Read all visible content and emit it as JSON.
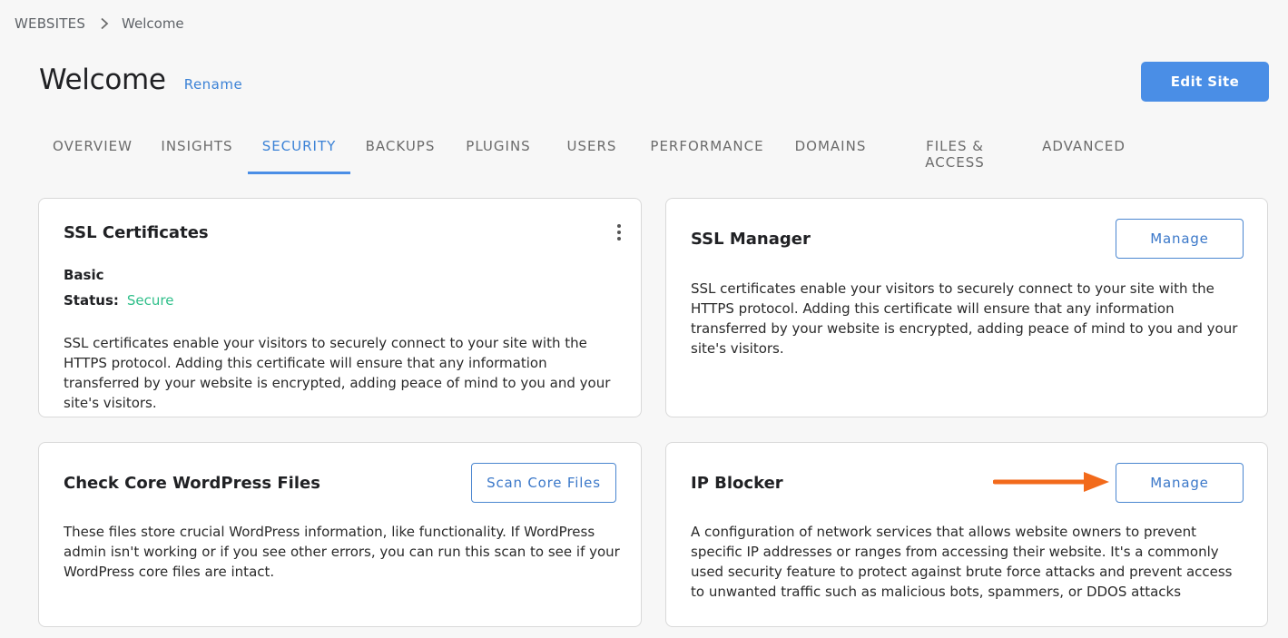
{
  "breadcrumb": {
    "root": "WEBSITES",
    "current": "Welcome"
  },
  "header": {
    "title": "Welcome",
    "rename_label": "Rename",
    "edit_label": "Edit Site"
  },
  "tabs": [
    "OVERVIEW",
    "INSIGHTS",
    "SECURITY",
    "BACKUPS",
    "PLUGINS",
    "USERS",
    "PERFORMANCE",
    "DOMAINS",
    "FILES & ACCESS",
    "ADVANCED"
  ],
  "active_tab": "SECURITY",
  "ssl_certificates": {
    "title": "SSL Certificates",
    "plan": "Basic",
    "status_label": "Status:",
    "status_value": "Secure",
    "description": "SSL certificates enable your visitors to securely connect to your site with the HTTPS protocol. Adding this certificate will ensure that any information transferred by your website is encrypted, adding peace of mind to you and your site's visitors."
  },
  "ssl_manager": {
    "title": "SSL Manager",
    "button_label": "Manage",
    "description": "SSL certificates enable your visitors to securely connect to your site with the HTTPS protocol. Adding this certificate will ensure that any information transferred by your website is encrypted, adding peace of mind to you and your site's visitors."
  },
  "core_files": {
    "title": "Check Core WordPress Files",
    "button_label": "Scan Core Files",
    "description": "These files store crucial WordPress information, like functionality. If WordPress admin isn't working or if you see other errors, you can run this scan to see if your WordPress core files are intact."
  },
  "ip_blocker": {
    "title": "IP Blocker",
    "button_label": "Manage",
    "description": "A configuration of network services that allows website owners to prevent specific IP addresses or ranges from accessing their website. It's a commonly used security feature to protect against brute force attacks and prevent access to unwanted traffic such as malicious bots, spammers, or DDOS attacks"
  },
  "colors": {
    "accent": "#4a8ee6",
    "link": "#3b82d6",
    "status_secure": "#2fbf8a",
    "annotation_arrow": "#f26a1b",
    "background": "#f7f7f7"
  }
}
